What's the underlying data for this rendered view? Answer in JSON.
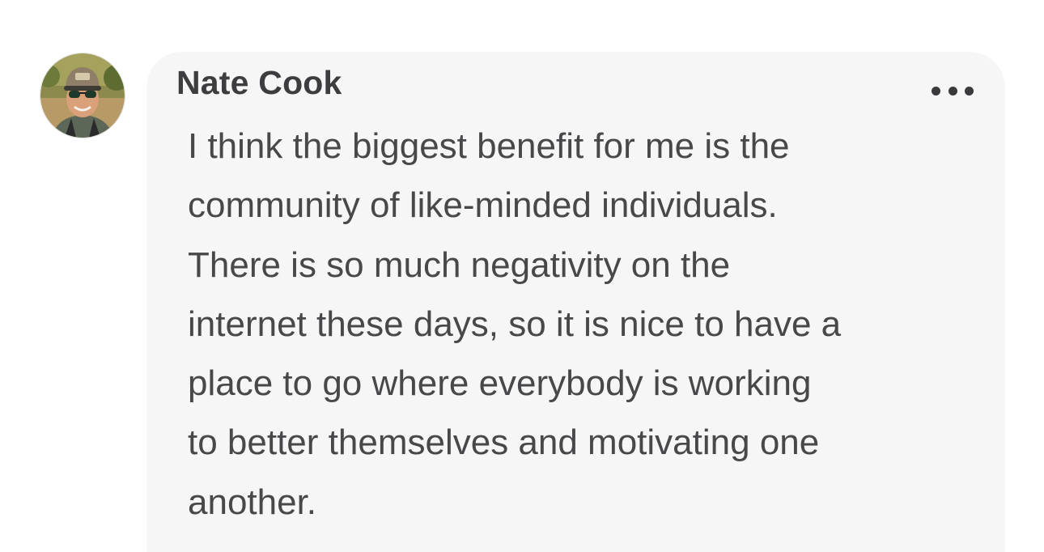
{
  "comment": {
    "author": "Nate Cook",
    "body_lines": [
      "I think the biggest benefit for me is the",
      "community of like-minded individuals.",
      "There is so much negativity on the",
      "internet these days, so it is nice to have a",
      "place to go where everybody is working",
      "to better themselves and motivating one",
      "another."
    ],
    "more_icon": "ellipsis-horizontal-icon",
    "avatar_icon": "user-avatar-photo"
  },
  "colors": {
    "bubble_background": "#f6f6f6",
    "author_text": "#3d3d3f",
    "body_text": "#48484a"
  }
}
